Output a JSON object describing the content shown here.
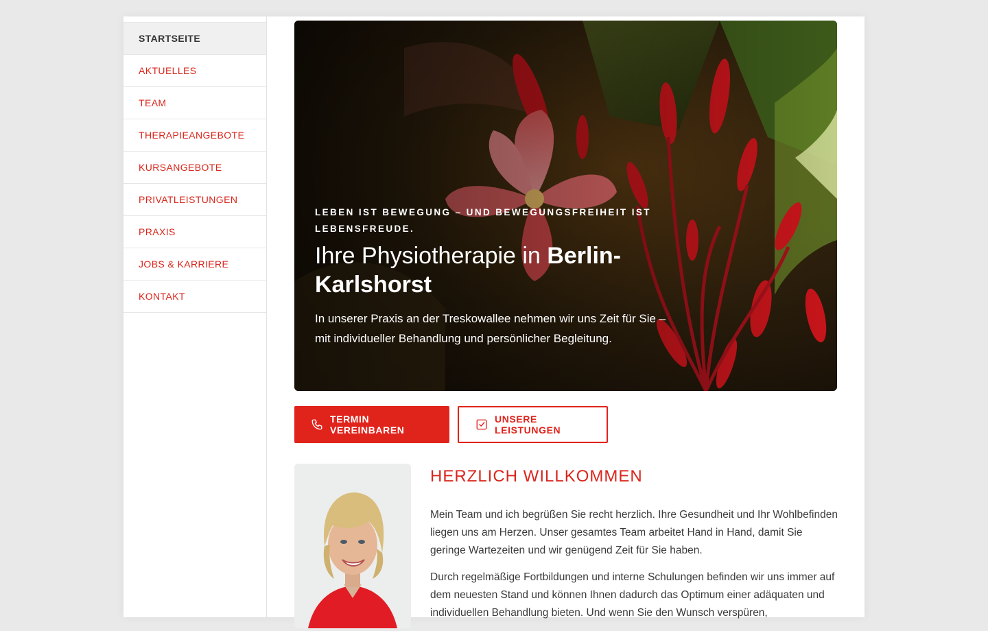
{
  "nav": {
    "items": [
      {
        "label": "STARTSEITE",
        "active": true
      },
      {
        "label": "AKTUELLES",
        "active": false
      },
      {
        "label": "TEAM",
        "active": false
      },
      {
        "label": "THERAPIEANGEBOTE",
        "active": false
      },
      {
        "label": "KURSANGEBOTE",
        "active": false
      },
      {
        "label": "PRIVATLEISTUNGEN",
        "active": false
      },
      {
        "label": "PRAXIS",
        "active": false
      },
      {
        "label": "JOBS & KARRIERE",
        "active": false
      },
      {
        "label": "KONTAKT",
        "active": false
      }
    ]
  },
  "hero": {
    "kicker": "LEBEN IST BEWEGUNG – UND BEWEGUNGSFREIHEIT IST LEBENSFREUDE.",
    "headline_part1": "Ihre Physiotherapie in ",
    "headline_part2": "Berlin-Karlshorst",
    "lead": "In unserer Praxis an der Treskowallee nehmen wir uns Zeit für Sie – mit individueller Behandlung und persönlicher Begleitung."
  },
  "buttons": {
    "primary_label": "TERMIN VEREINBAREN",
    "primary_icon": "phone-icon",
    "secondary_label": "UNSERE LEISTUNGEN",
    "secondary_icon": "checkbox-icon"
  },
  "welcome": {
    "title": "HERZLICH WILLKOMMEN",
    "paragraph1": "Mein Team und ich begrüßen Sie recht herzlich. Ihre Gesundheit und Ihr Wohlbefinden liegen uns am Herzen. Unser gesamtes Team arbeitet Hand in Hand, damit Sie geringe Wartezeiten und wir genügend Zeit für Sie haben.",
    "paragraph2": "Durch regelmäßige Fortbildungen und interne Schulungen befinden wir uns immer auf dem neuesten Stand und können Ihnen dadurch das Optimum einer adäquaten und individuellen Behandlung bieten. Und wenn Sie den Wunsch verspüren,"
  },
  "colors": {
    "accent": "#e0231b",
    "nav_text": "#d9261c",
    "background": "#e9e9e9"
  }
}
